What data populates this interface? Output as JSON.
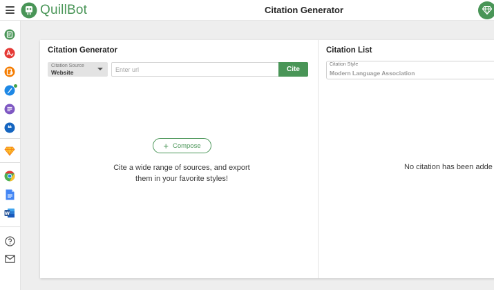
{
  "app": {
    "brand": "QuillBot",
    "page_title": "Citation Generator",
    "accent": "#499557"
  },
  "sidebar": {
    "items": [
      {
        "name": "paraphraser-icon",
        "color": "#499557"
      },
      {
        "name": "grammar-checker-icon",
        "color": "#e53935"
      },
      {
        "name": "plagiarism-checker-icon",
        "color": "#f57c00"
      },
      {
        "name": "co-writer-icon",
        "color": "#1e88e5"
      },
      {
        "name": "summarizer-icon",
        "color": "#7e57c2"
      },
      {
        "name": "citation-generator-icon",
        "color": "#1565c0"
      },
      {
        "name": "premium-diamond-icon",
        "color": "#f9a825"
      },
      {
        "name": "chrome-extension-icon",
        "color": "#4caf50"
      },
      {
        "name": "google-docs-icon",
        "color": "#4285f4"
      },
      {
        "name": "word-icon",
        "color": "#2b579a"
      },
      {
        "name": "help-icon",
        "color": "#555555"
      },
      {
        "name": "mail-icon",
        "color": "#555555"
      }
    ]
  },
  "generator": {
    "title": "Citation Generator",
    "source_label": "Citation Source",
    "source_value": "Website",
    "url_placeholder": "Enter url",
    "cite_label": "Cite",
    "compose_label": "Compose",
    "empty_line1": "Cite a wide range of sources, and export",
    "empty_line2": "them in your favorite styles!"
  },
  "citation_list": {
    "title": "Citation List",
    "style_label": "Citation Style",
    "style_value": "Modern Language Association",
    "empty_text": "No citation has been adde"
  }
}
